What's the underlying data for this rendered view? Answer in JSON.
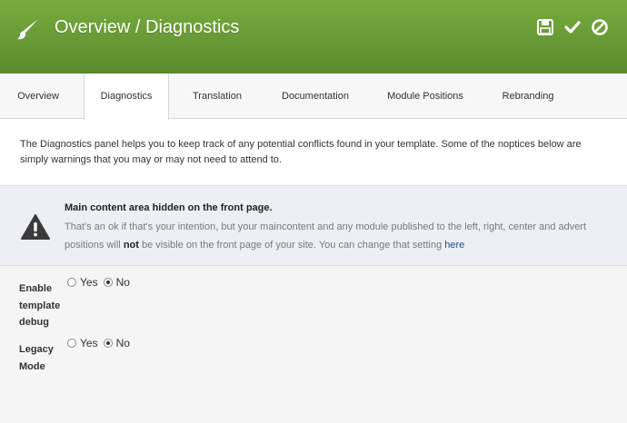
{
  "header": {
    "title": "Overview / Diagnostics",
    "brand_icon": "paintbrush-icon",
    "actions": [
      {
        "name": "save",
        "icon": "save-icon"
      },
      {
        "name": "apply",
        "icon": "checkmark-icon"
      },
      {
        "name": "cancel",
        "icon": "cancel-icon"
      }
    ],
    "color": "#6c9f38"
  },
  "tabs": [
    {
      "label": "Overview"
    },
    {
      "label": "Diagnostics",
      "active": true
    },
    {
      "label": "Translation"
    },
    {
      "label": "Documentation"
    },
    {
      "label": "Module Positions"
    },
    {
      "label": "Rebranding"
    }
  ],
  "intro": "The Diagnostics panel helps you to keep track of any potential conflicts found in your template. Some of the noptices below are simply warnings that you may or may not need to attend to.",
  "notice": {
    "icon": "warning-icon",
    "title": "Main content area hidden on the front page.",
    "body_before": "That's an ok if that's your intention, but your maincontent and any module published to the left, right, center and advert positions will ",
    "body_bold": "not",
    "body_after": " be visible on the front page of your site. You can change that setting ",
    "link_text": "here",
    "link_color": "#1a4fa0"
  },
  "fields": {
    "debug": {
      "label": "Enable template debug",
      "yes": "Yes",
      "no": "No",
      "selected": "No"
    },
    "legacy": {
      "label": "Legacy Mode",
      "yes": "Yes",
      "no": "No",
      "selected": "No"
    }
  }
}
